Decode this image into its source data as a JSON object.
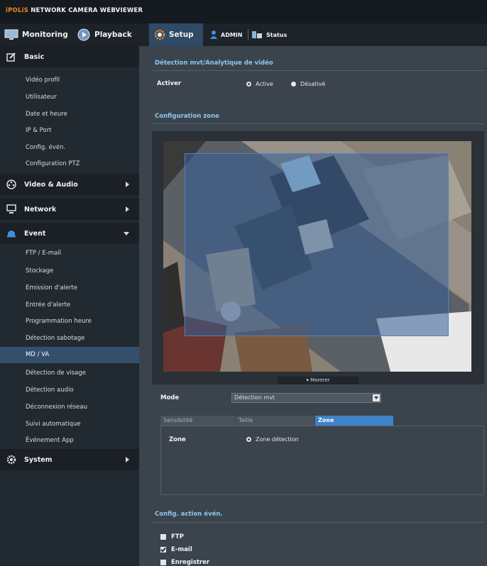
{
  "header": {
    "brand_prefix": "iPOLiS",
    "brand_rest": " NETWORK CAMERA WEBVIEWER",
    "accent_color": "#f08a1c"
  },
  "nav": {
    "monitoring": "Monitoring",
    "playback": "Playback",
    "setup": "Setup",
    "admin": "ADMIN",
    "status": "Status"
  },
  "sidebar": {
    "basic": {
      "label": "Basic",
      "items": [
        "Vidéo profil",
        "Utilisateur",
        "Date et heure",
        "IP & Port",
        "Config. évén.",
        "Configuration PTZ"
      ]
    },
    "video_audio": "Video & Audio",
    "network": "Network",
    "event": {
      "label": "Event",
      "items": [
        "FTP / E-mail",
        "Stockage",
        "Emission d'alerte",
        "Entrée d'alerte",
        "Programmation heure",
        "Détection sabotage",
        "MD / VA",
        "Détection de visage",
        "Détection audio",
        "Déconnexion réseau",
        "Suivi automatique",
        "Événement App"
      ],
      "active_item": "MD / VA"
    },
    "system": "System"
  },
  "main": {
    "section_title": "Détection mvt/Analytique de vidéo",
    "activer_label": "Activer",
    "radio_active": "Active",
    "radio_desactive": "Désativé",
    "zone_config_title": "Configuration zone",
    "show_button": "Montrer",
    "mode_label": "Mode",
    "mode_value": "Détection mvt",
    "tabs": [
      "Sensibilité",
      "Taille",
      "Zone"
    ],
    "selected_tab": "Zone",
    "zone_label": "Zone",
    "zone_radio": "Zone détection",
    "action_title": "Config. action évén.",
    "actions": [
      {
        "label": "FTP",
        "checked": false
      },
      {
        "label": "E-mail",
        "checked": true
      },
      {
        "label": "Enregistrer",
        "checked": false
      }
    ]
  }
}
